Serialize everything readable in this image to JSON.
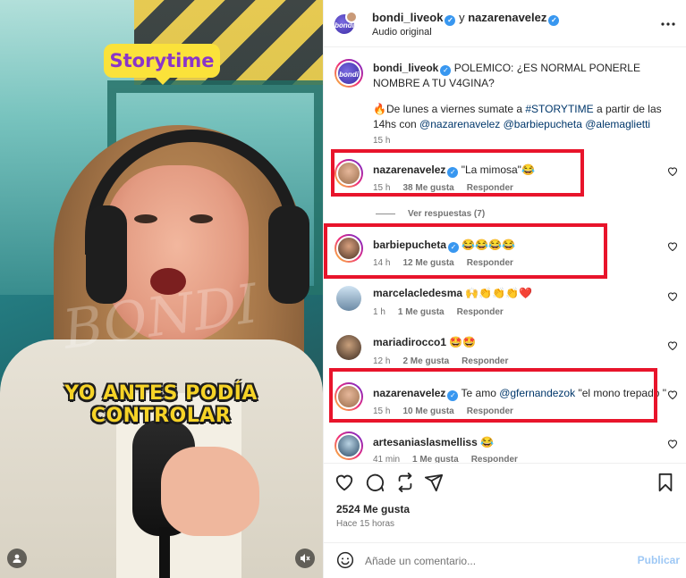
{
  "video": {
    "badge": "Storytime",
    "caption_line1": "YO ANTES PODÍA",
    "caption_line2": "CONTROLAR",
    "watermark": "BONDI"
  },
  "header": {
    "user1": "bondi_liveok",
    "joiner": "y",
    "user2": "nazarenavelez",
    "subtitle": "Audio original",
    "more_icon": "more-horizontal-icon"
  },
  "post": {
    "user": "bondi_liveok",
    "text_line1": "POLEMICO: ¿ES NORMAL PONERLE NOMBRE A TU V4GINA?",
    "text_line2_pre": "🔥De lunes a viernes sumate a ",
    "hashtag": "#STORYTIME",
    "text_line2_post": " a partir de las 14hs con ",
    "mention1": "@nazarenavelez",
    "mention2": "@barbiepucheta",
    "mention3": "@alemaglietti",
    "time": "15 h"
  },
  "comments": [
    {
      "user": "nazarenavelez",
      "verified": true,
      "text": "\"La mimosa\"😂",
      "time": "15 h",
      "likes": "38 Me gusta",
      "reply": "Responder",
      "highlight": true
    },
    {
      "user": "barbiepucheta",
      "verified": true,
      "text": "😂😂😂😂",
      "time": "14 h",
      "likes": "12 Me gusta",
      "reply": "Responder",
      "highlight": true
    },
    {
      "user": "marcelacledesma",
      "verified": false,
      "text": "🙌👏👏👏❤️",
      "time": "1 h",
      "likes": "1 Me gusta",
      "reply": "Responder",
      "highlight": false
    },
    {
      "user": "mariadirocco1",
      "verified": false,
      "text": "🤩🤩",
      "time": "12 h",
      "likes": "2 Me gusta",
      "reply": "Responder",
      "highlight": false
    },
    {
      "user": "nazarenavelez",
      "verified": true,
      "text_pre": "Te amo ",
      "mention": "@gfernandezok",
      "text_post": " \"el mono trepado \"",
      "time": "15 h",
      "likes": "10 Me gusta",
      "reply": "Responder",
      "highlight": true
    },
    {
      "user": "artesaniaslasmelliss",
      "verified": false,
      "text": "😂",
      "time": "41 min",
      "likes": "1 Me gusta",
      "reply": "Responder",
      "highlight": false
    }
  ],
  "view_replies": "Ver respuestas (7)",
  "actions": {
    "likes": "2524 Me gusta",
    "time_ago": "Hace 15 horas"
  },
  "composer": {
    "placeholder": "Añade un comentario...",
    "publish": "Publicar"
  },
  "colors": {
    "highlight": "#e8142b",
    "link": "#00376b",
    "verified": "#3897f0",
    "caption": "#f6d327",
    "badge_bg": "#fbe23a",
    "badge_text": "#8a35c9"
  }
}
